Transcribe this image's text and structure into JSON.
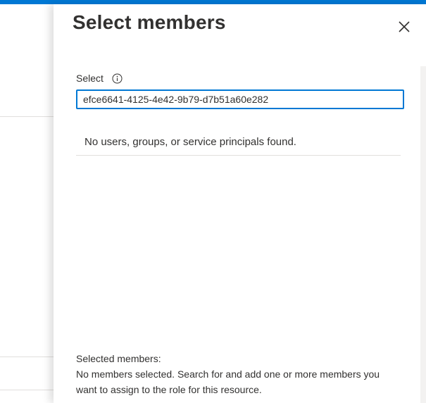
{
  "panel": {
    "title": "Select members"
  },
  "search": {
    "label": "Select",
    "value": "efce6641-4125-4e42-9b79-d7b51a60e282"
  },
  "results": {
    "message": "No users, groups, or service principals found."
  },
  "selected": {
    "heading": "Selected members:",
    "empty_text": "No members selected. Search for and add one or more members you want to assign to the role for this resource."
  },
  "colors": {
    "accent": "#0078d4",
    "text": "#323130",
    "divider": "#e1dfdd"
  },
  "icons": {
    "close": "close-icon",
    "info": "info-icon"
  }
}
